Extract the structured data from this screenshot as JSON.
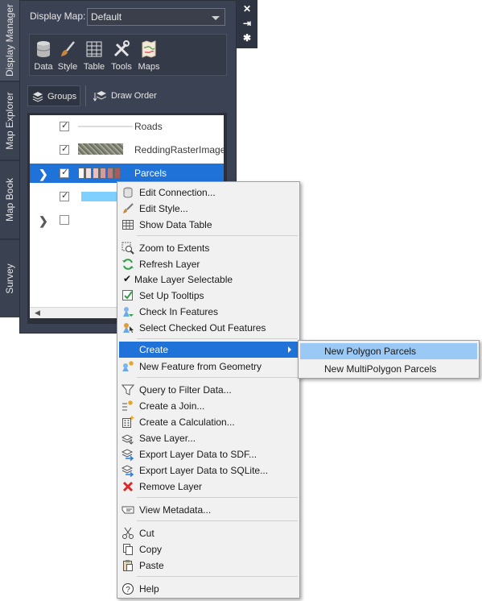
{
  "tabs": [
    "Display Manager",
    "Map Explorer",
    "Map Book",
    "Survey"
  ],
  "side_controls": [
    "✕",
    "⇥",
    "✱"
  ],
  "display_map": {
    "label": "Display Map:",
    "value": "Default"
  },
  "ribbon": [
    {
      "label": "Data",
      "icon": "database-icon"
    },
    {
      "label": "Style",
      "icon": "brush-icon"
    },
    {
      "label": "Table",
      "icon": "table-icon"
    },
    {
      "label": "Tools",
      "icon": "tools-icon"
    },
    {
      "label": "Maps",
      "icon": "maps-icon"
    }
  ],
  "view_buttons": {
    "groups": "Groups",
    "draw_order": "Draw Order"
  },
  "layers": [
    {
      "name": "Roads",
      "checked": true,
      "expandable": false,
      "selected": false,
      "swatch": "line"
    },
    {
      "name": "ReddingRasterImage",
      "checked": true,
      "expandable": false,
      "selected": false,
      "swatch": "raster"
    },
    {
      "name": "Parcels",
      "checked": true,
      "expandable": true,
      "selected": true,
      "swatch": "theme"
    },
    {
      "name": "",
      "checked": true,
      "expandable": false,
      "selected": false,
      "swatch": "blue"
    },
    {
      "name": "",
      "checked": false,
      "expandable": true,
      "selected": false,
      "swatch": "none"
    }
  ],
  "context_menu": {
    "items": [
      {
        "label": "Edit Connection...",
        "icon": "database-icon",
        "type": "item"
      },
      {
        "label": "Edit Style...",
        "icon": "brush-icon",
        "type": "item"
      },
      {
        "label": "Show Data Table",
        "icon": "table-icon",
        "type": "item"
      },
      {
        "type": "separator"
      },
      {
        "label": "Zoom to Extents",
        "icon": "zoom-extents-icon",
        "type": "item"
      },
      {
        "label": "Refresh Layer",
        "icon": "refresh-icon",
        "type": "item"
      },
      {
        "label": "Make Layer Selectable",
        "icon": "check-icon",
        "type": "item"
      },
      {
        "label": "Set Up Tooltips",
        "icon": "tooltip-icon",
        "type": "item"
      },
      {
        "label": "Check In Features",
        "icon": "check-in-icon",
        "type": "item"
      },
      {
        "label": "Select Checked Out Features",
        "icon": "select-features-icon",
        "type": "item"
      },
      {
        "type": "separator"
      },
      {
        "label": "Create",
        "icon": "",
        "type": "submenu",
        "highlighted": true
      },
      {
        "label": "New Feature from Geometry",
        "icon": "new-feature-icon",
        "type": "item"
      },
      {
        "type": "separator"
      },
      {
        "label": "Query to Filter Data...",
        "icon": "query-icon",
        "type": "item"
      },
      {
        "label": "Create a Join...",
        "icon": "join-icon",
        "type": "item"
      },
      {
        "label": "Create a Calculation...",
        "icon": "calculation-icon",
        "type": "item"
      },
      {
        "label": "Save Layer...",
        "icon": "save-layer-icon",
        "type": "item"
      },
      {
        "label": "Export Layer Data to SDF...",
        "icon": "export-sdf-icon",
        "type": "item"
      },
      {
        "label": "Export Layer Data to SQLite...",
        "icon": "export-sqlite-icon",
        "type": "item"
      },
      {
        "label": "Remove Layer",
        "icon": "remove-icon",
        "type": "item"
      },
      {
        "type": "separator"
      },
      {
        "label": "View Metadata...",
        "icon": "metadata-icon",
        "type": "item"
      },
      {
        "type": "separator"
      },
      {
        "label": "Cut",
        "icon": "cut-icon",
        "type": "item"
      },
      {
        "label": "Copy",
        "icon": "copy-icon",
        "type": "item"
      },
      {
        "label": "Paste",
        "icon": "paste-icon",
        "type": "item"
      },
      {
        "type": "separator"
      },
      {
        "label": "Help",
        "icon": "help-icon",
        "type": "item"
      }
    ]
  },
  "submenu": {
    "items": [
      {
        "label": "New Polygon Parcels",
        "highlighted": true
      },
      {
        "label": "New MultiPolygon Parcels",
        "highlighted": false
      }
    ]
  },
  "colors": {
    "accent": "#1e72d8",
    "submenu_highlight": "#99c9f4",
    "panel": "#3b4253"
  }
}
